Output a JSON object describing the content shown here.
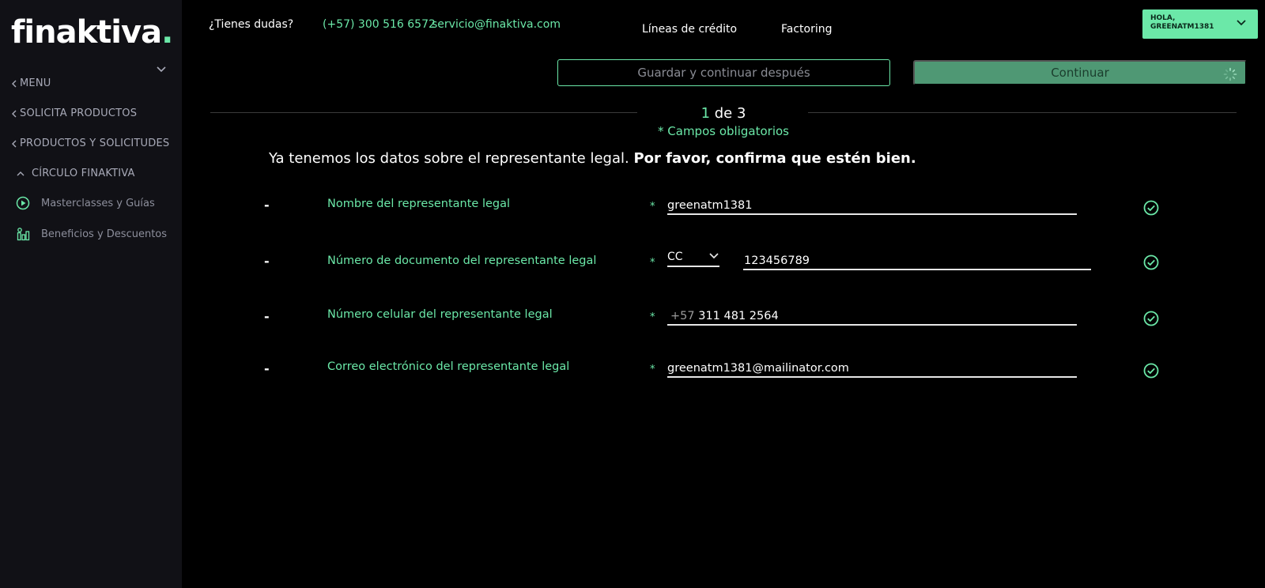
{
  "sidebar": {
    "logo_main": "finaktiva",
    "logo_dot": ".",
    "menu_label": "MENU",
    "items": [
      {
        "label": "SOLICITA PRODUCTOS"
      },
      {
        "label": "PRODUCTOS Y SOLICITUDES"
      },
      {
        "label": "CÍRCULO FINAKTIVA"
      }
    ],
    "sub_items": [
      {
        "label": "Masterclasses y Guías",
        "icon": "play-circle-icon"
      },
      {
        "label": "Beneficios y Descuentos",
        "icon": "benefits-icon"
      }
    ]
  },
  "header": {
    "question": "¿Tienes dudas?",
    "phone": "(+57) 300 516 6572",
    "email": "servicio@finaktiva.com",
    "nav": [
      "Líneas de crédito",
      "Factoring"
    ],
    "user_greeting": "HOLA,",
    "user_name": "GREENATM1381"
  },
  "actions": {
    "save_label": "Guardar y continuar después",
    "continue_label": "Continuar"
  },
  "step": {
    "current": "1",
    "rest": " de 3",
    "required_note": "* Campos obligatorios"
  },
  "intro": {
    "normal": "Ya tenemos los datos sobre el representante legal. ",
    "bold": "Por favor, confirma que estén bien."
  },
  "form": {
    "dash": "-",
    "star": "*",
    "rows": [
      {
        "label": "Nombre del representante legal",
        "value": "greenatm1381"
      },
      {
        "label": "Número de documento del representante legal",
        "doc_type": "CC",
        "value": "123456789"
      },
      {
        "label": "Número celular del representante legal",
        "prefix": "+57",
        "value": "311 481 2564"
      },
      {
        "label": "Correo electrónico del representante legal",
        "value": "greenatm1381@mailinator.com"
      }
    ]
  },
  "colors": {
    "accent": "#6be8a8",
    "sidebar_bg": "#111116",
    "continue_bg": "#4f9874"
  }
}
